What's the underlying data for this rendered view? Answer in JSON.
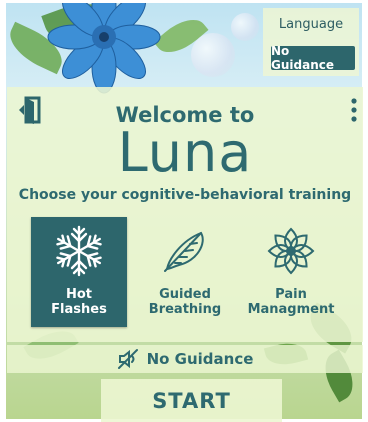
{
  "language": {
    "label": "Language",
    "selected": "No Guidance"
  },
  "welcome": {
    "greeting": "Welcome to",
    "app_name": "Luna",
    "subtitle": "Choose your cognitive-behavioral training"
  },
  "trainings": [
    {
      "label": "Hot Flashes",
      "icon": "snowflake-icon",
      "selected": true
    },
    {
      "label": "Guided Breathing",
      "icon": "feather-icon",
      "selected": false
    },
    {
      "label": "Pain Managment",
      "icon": "lotus-icon",
      "selected": false
    }
  ],
  "guidance": {
    "label": "No Guidance",
    "icon": "muted-speaker-icon"
  },
  "start": {
    "label": "START"
  },
  "colors": {
    "primary": "#2d666c",
    "panel": "#ecf6d2",
    "text": "#2e6a70"
  }
}
